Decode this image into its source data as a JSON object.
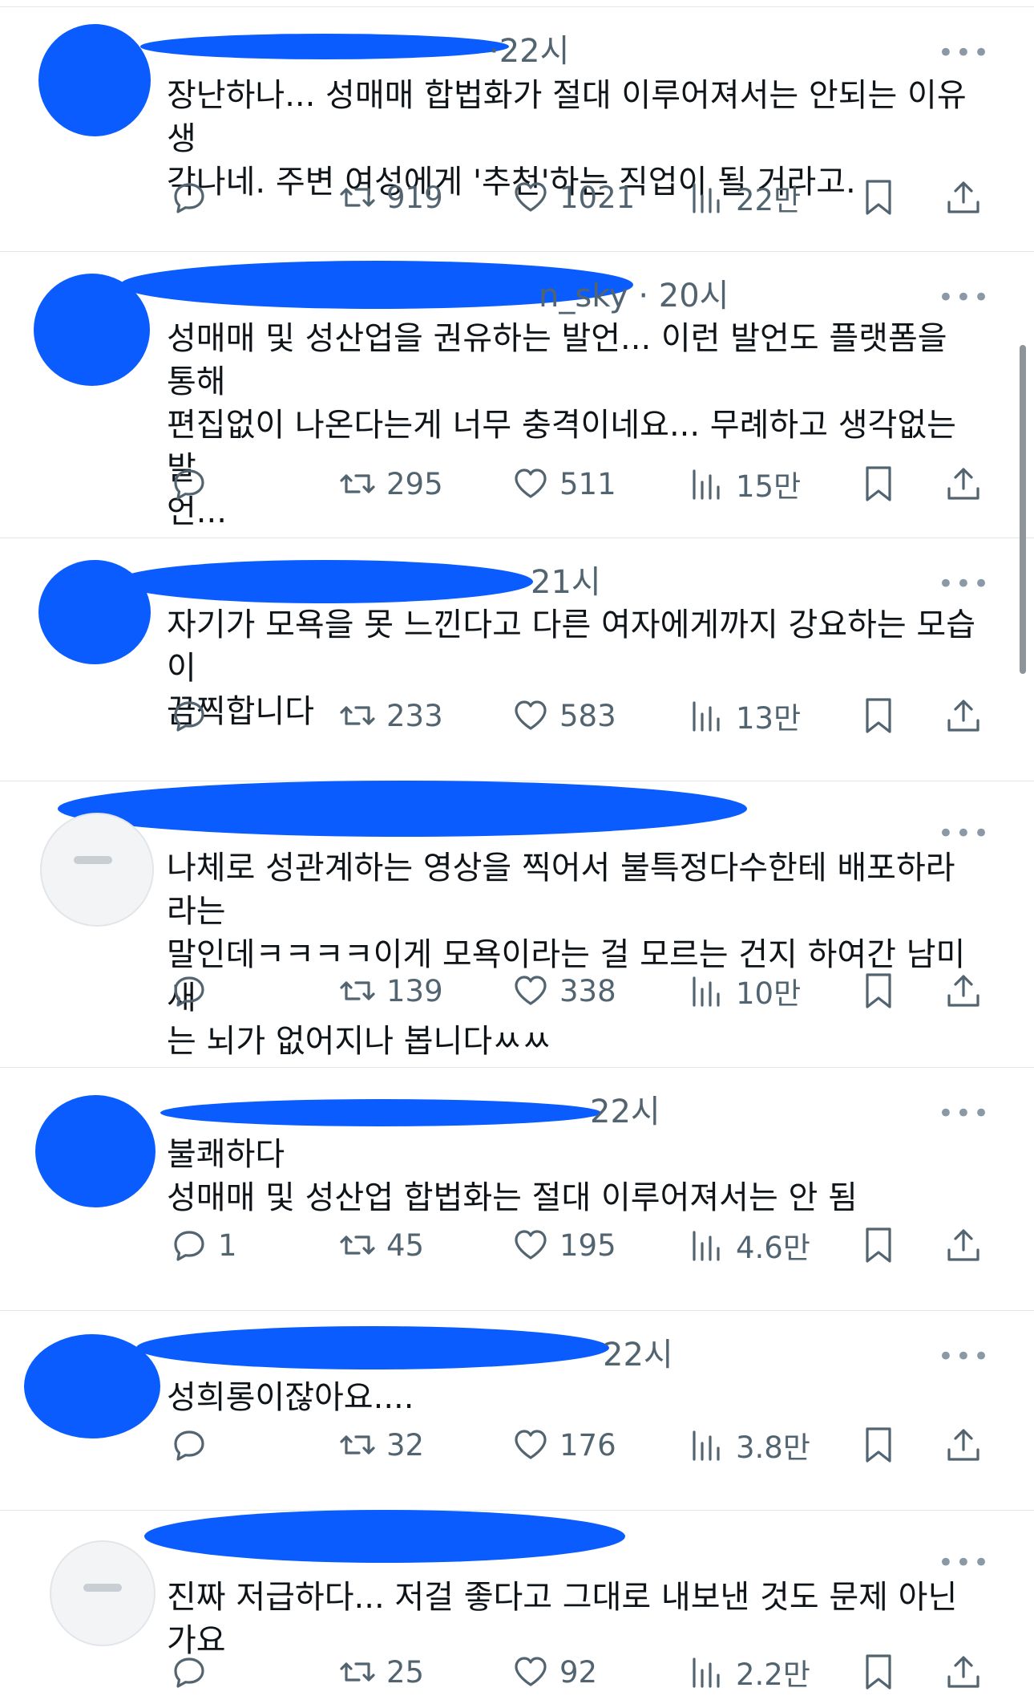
{
  "feed": {
    "tweets": [
      {
        "header_tail": "·22시",
        "text": "장난하나... 성매매 합법화가 절대 이루어져서는 안되는 이유 생\n각나네. 주변 여성에게 '추천'하는 직업이 될 거라고.",
        "replies": "",
        "retweets": "919",
        "likes": "1021",
        "views": "22만"
      },
      {
        "header_tail": "n_sky · 20시",
        "text": "성매매 및 성산업을 권유하는 발언... 이런 발언도 플랫폼을 통해\n편집없이 나온다는게 너무 충격이네요... 무례하고 생각없는 발\n언...",
        "replies": "",
        "retweets": "295",
        "likes": "511",
        "views": "15만"
      },
      {
        "header_tail": "21시",
        "text": "자기가 모욕을 못 느낀다고 다른 여자에게까지 강요하는 모습이\n끔찍합니다",
        "replies": "",
        "retweets": "233",
        "likes": "583",
        "views": "13만"
      },
      {
        "header_tail": "",
        "text": "나체로 성관계하는 영상을 찍어서 불특정다수한테 배포하라라는\n말인데ㅋㅋㅋㅋ이게 모욕이라는 걸 모르는 건지 하여간 남미새\n는 뇌가 없어지나 봅니다ㅆㅆ",
        "replies": "",
        "retweets": "139",
        "likes": "338",
        "views": "10만"
      },
      {
        "header_tail": "22시",
        "text": "불쾌하다\n성매매 및 성산업 합법화는 절대 이루어져서는 안 됨",
        "replies": "1",
        "retweets": "45",
        "likes": "195",
        "views": "4.6만"
      },
      {
        "header_tail": "22시",
        "text": "성희롱이잖아요....",
        "replies": "",
        "retweets": "32",
        "likes": "176",
        "views": "3.8만"
      },
      {
        "header_tail": "",
        "text": "진짜 저급하다... 저걸 좋다고 그대로 내보낸 것도 문제 아닌가요",
        "replies": "",
        "retweets": "25",
        "likes": "92",
        "views": "2.2만"
      }
    ]
  },
  "icons": {
    "reply": "reply-icon",
    "retweet": "retweet-icon",
    "like": "heart-icon",
    "views": "views-icon",
    "bookmark": "bookmark-icon",
    "share": "share-icon",
    "more": "more-icon"
  },
  "colors": {
    "redaction": "#0a5cff",
    "text": "#0f1419",
    "secondary": "#536471",
    "divider": "#e3e7ea"
  }
}
